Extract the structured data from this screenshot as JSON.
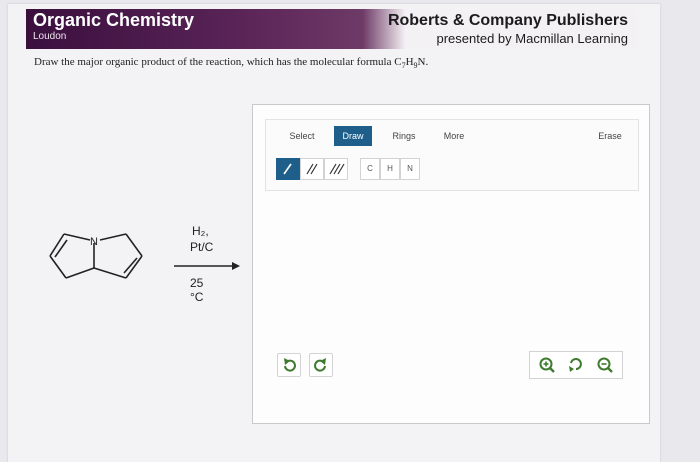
{
  "header": {
    "title": "Organic Chemistry",
    "author": "Loudon",
    "publisher": "Roberts & Company Publishers",
    "presented_by": "presented by Macmillan Learning"
  },
  "question": {
    "text_prefix": "Draw the major organic product of the reaction, which has the molecular formula C",
    "sub_c": "7",
    "h_label": "H",
    "sub_h": "9",
    "suffix": "N."
  },
  "reaction": {
    "atom_label": "N",
    "reagent_line1": "H₂,",
    "reagent_line2": "Pt/C",
    "condition": "25 °C"
  },
  "sketcher": {
    "tabs": [
      "Select",
      "Draw",
      "Rings",
      "More",
      "Erase"
    ],
    "active_tab": "Draw",
    "atoms": [
      "C",
      "H",
      "N"
    ],
    "bond_tools": [
      "single-bond",
      "double-bond",
      "triple-bond"
    ],
    "selected_bond": "single-bond",
    "icons": {
      "undo": "undo-icon",
      "redo": "redo-icon",
      "zoom_in": "zoom-in-icon",
      "reset": "reset-zoom-icon",
      "zoom_out": "zoom-out-icon"
    },
    "accent_color": "#1d5f8a",
    "icon_color": "#3e7b2f"
  }
}
